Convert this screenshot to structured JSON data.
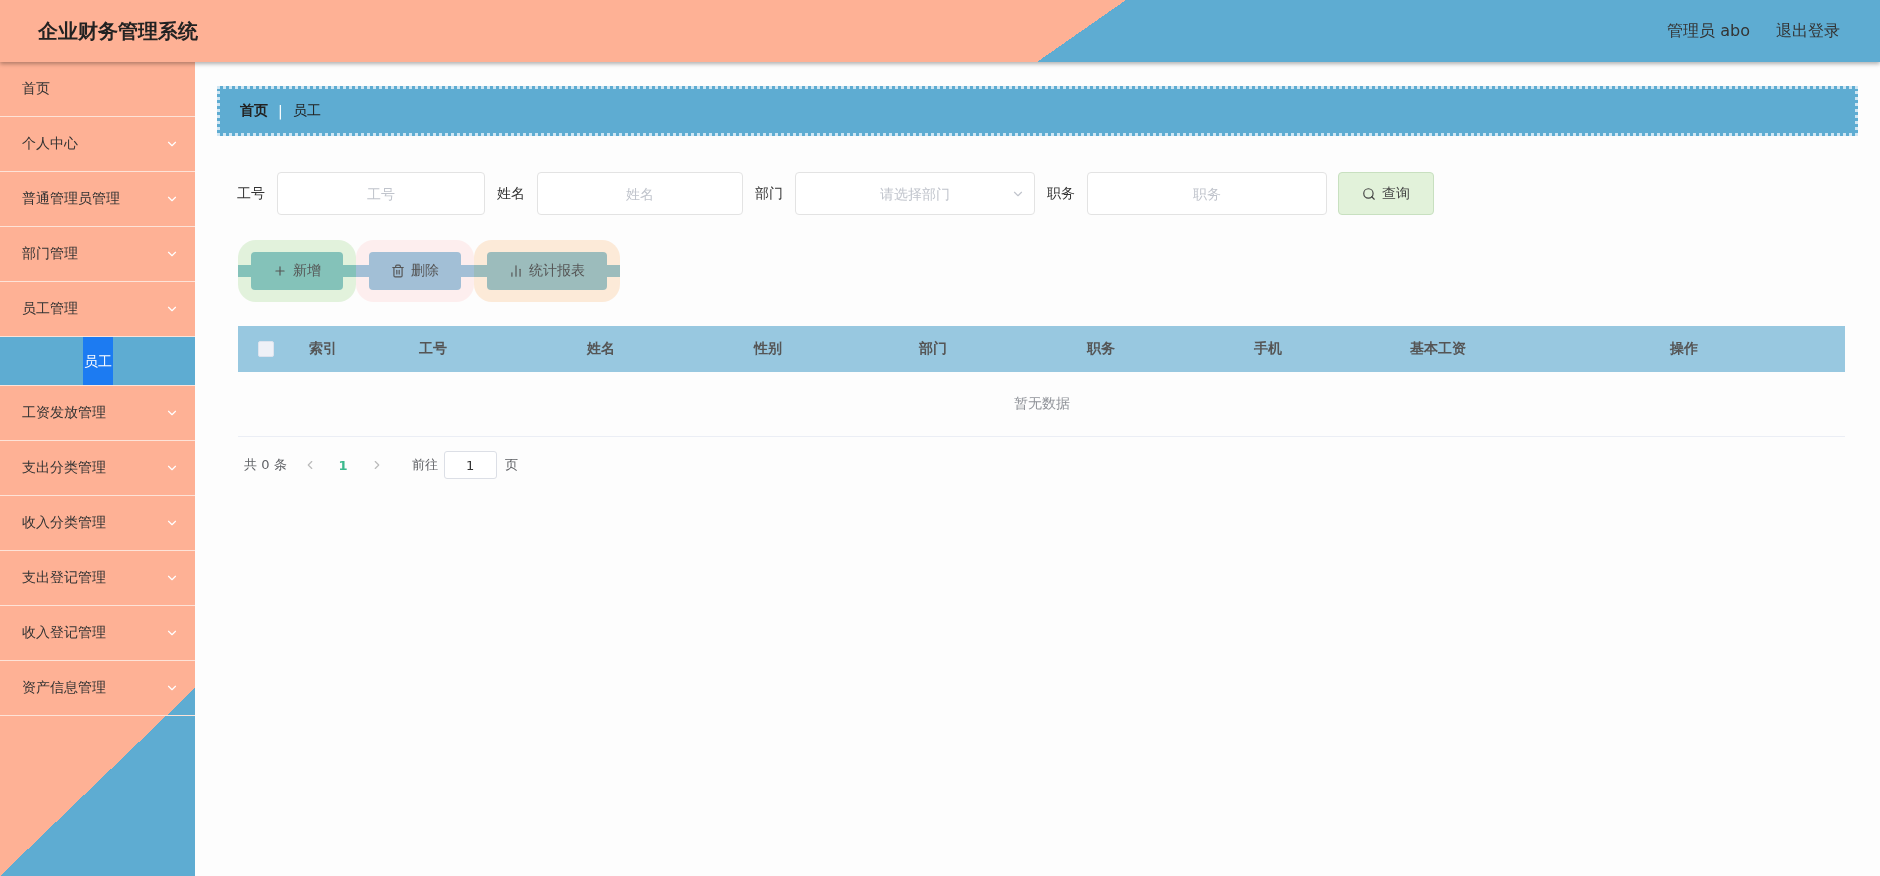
{
  "header": {
    "title": "企业财务管理系统",
    "user": "管理员 abo",
    "logout": "退出登录"
  },
  "sidebar": {
    "items": [
      {
        "label": "首页"
      },
      {
        "label": "个人中心",
        "expandable": true
      },
      {
        "label": "普通管理员管理",
        "expandable": true
      },
      {
        "label": "部门管理",
        "expandable": true
      },
      {
        "label": "员工管理",
        "expandable": true,
        "children": [
          {
            "label": "员工",
            "selected": true
          }
        ]
      },
      {
        "label": "工资发放管理",
        "expandable": true
      },
      {
        "label": "支出分类管理",
        "expandable": true
      },
      {
        "label": "收入分类管理",
        "expandable": true
      },
      {
        "label": "支出登记管理",
        "expandable": true
      },
      {
        "label": "收入登记管理",
        "expandable": true
      },
      {
        "label": "资产信息管理",
        "expandable": true
      }
    ]
  },
  "breadcrumb": {
    "items": [
      "首页",
      "员工"
    ],
    "separator": "|"
  },
  "search": {
    "fields": [
      {
        "label": "工号",
        "placeholder": "工号",
        "kind": "input"
      },
      {
        "label": "姓名",
        "placeholder": "姓名",
        "kind": "input"
      },
      {
        "label": "部门",
        "placeholder": "请选择部门",
        "kind": "select"
      },
      {
        "label": "职务",
        "placeholder": "职务",
        "kind": "input"
      }
    ],
    "button": "查询"
  },
  "actions": [
    {
      "label": "新增",
      "kind": "add"
    },
    {
      "label": "删除",
      "kind": "delete"
    },
    {
      "label": "统计报表",
      "kind": "report"
    }
  ],
  "table": {
    "checked": false,
    "columns": [
      "索引",
      "工号",
      "姓名",
      "性别",
      "部门",
      "职务",
      "手机",
      "基本工资",
      "操作"
    ],
    "empty": "暂无数据"
  },
  "pagination": {
    "total": "共 0 条",
    "pages": [
      {
        "label": "1",
        "selected": true
      }
    ],
    "goto": "前往",
    "page": "1",
    "suffix": "页"
  }
}
